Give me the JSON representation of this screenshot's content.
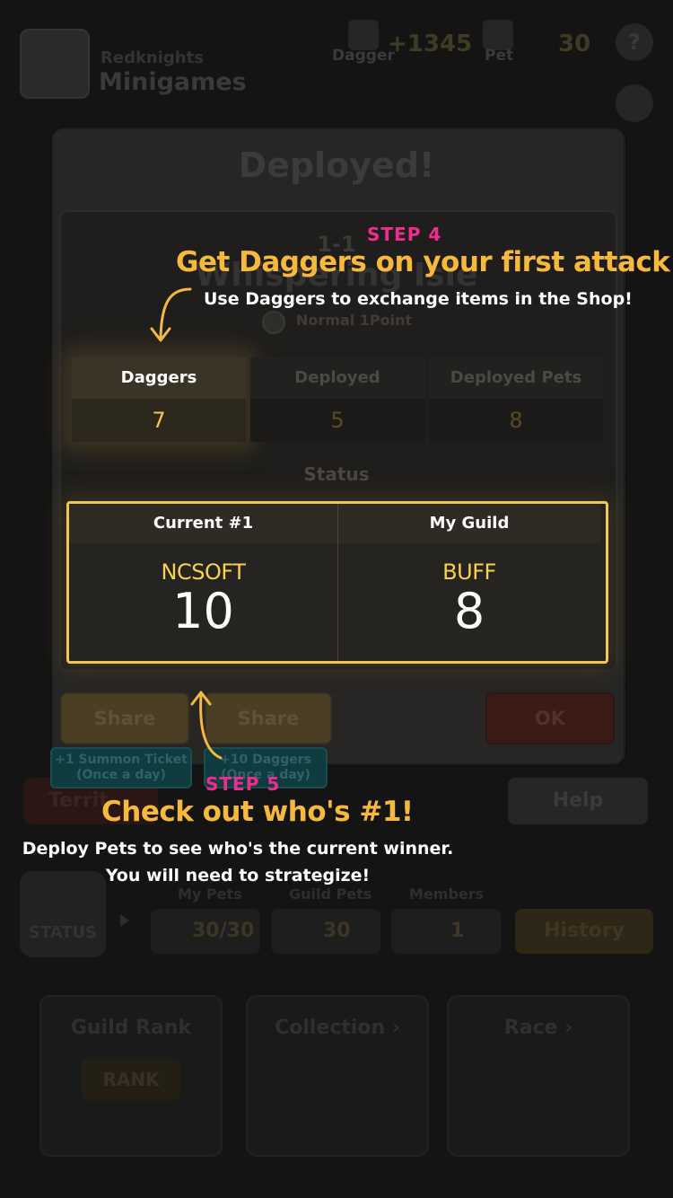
{
  "background": {
    "brand_top": "Redknights",
    "brand_bottom": "Minigames",
    "dagger_label": "Dagger",
    "dagger_count": "+1345",
    "pet_label": "Pet",
    "pet_count": "30",
    "help_symbol": "?",
    "territory_label": "Territ",
    "help_button": "Help",
    "status_badge": "STATUS",
    "my_pets_label": "My Pets",
    "my_pets_value": "30/30",
    "guild_pets_label": "Guild Pets",
    "guild_pets_value": "30",
    "members_label": "Members",
    "members_value": "1",
    "history_button": "History",
    "cards": [
      {
        "label": "Guild Rank",
        "art_text": "RANK"
      },
      {
        "label": "Collection ›"
      },
      {
        "label": "Race ›"
      }
    ]
  },
  "modal": {
    "title": "Deployed!",
    "stage_number": "1-1",
    "stage_name": "Whispering Isle",
    "difficulty": "Normal 1Point",
    "stats": [
      {
        "label": "Daggers",
        "value": "7"
      },
      {
        "label": "Deployed",
        "value": "5"
      },
      {
        "label": "Deployed Pets",
        "value": "8"
      }
    ],
    "status_heading": "Status",
    "status": [
      {
        "head": "Current #1",
        "name": "NCSOFT",
        "value": "10"
      },
      {
        "head": "My Guild",
        "name": "BUFF",
        "value": "8"
      }
    ],
    "share_sns": "Share (SNS)",
    "share_guild": "Share (Guild)",
    "ok": "OK",
    "tip_sns_line1": "+1 Summon Ticket",
    "tip_sns_line2": "(Once a day)",
    "tip_guild_line1": "+10 Daggers",
    "tip_guild_line2": "(Once a day)"
  },
  "tutorial": {
    "step4_label": "STEP 4",
    "step4_title": "Get Daggers on your first attack!",
    "step4_desc": "Use Daggers to exchange items in the Shop!",
    "step5_label": "STEP 5",
    "step5_title": "Check out who's #1!",
    "step5_desc_line1": "Deploy Pets to see who's the current winner.",
    "step5_desc_line2": "You will need to strategize!"
  },
  "colors": {
    "accent_gold": "#f1c84d",
    "step_pink": "#f22c8e",
    "title_orange": "#f6b93c",
    "value_yellow": "#f5c548"
  }
}
